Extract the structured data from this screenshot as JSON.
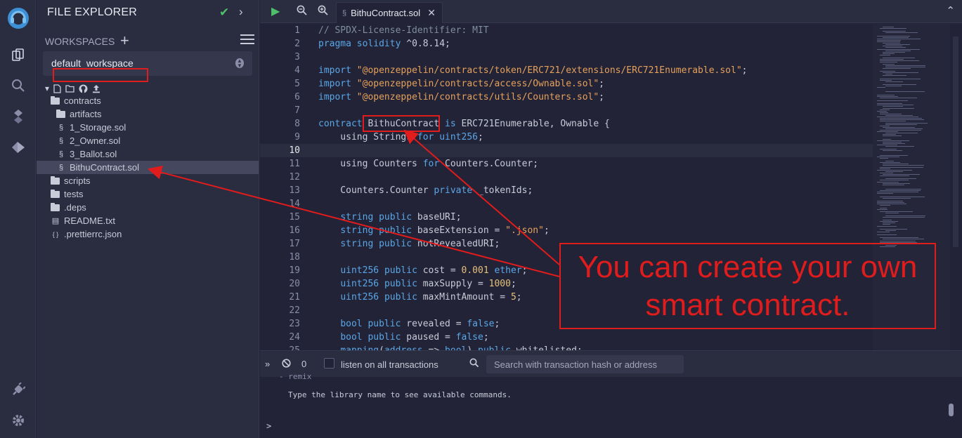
{
  "activity_bar": {
    "icons": [
      "remix-logo-icon",
      "file-explorer-icon",
      "search-icon",
      "solidity-compiler-icon",
      "deploy-run-icon",
      "plugin-manager-icon",
      "settings-icon"
    ]
  },
  "file_explorer": {
    "title": "FILE EXPLORER",
    "workspaces_label": "WORKSPACES",
    "workspace_selected": "default_workspace",
    "tree": [
      {
        "name": "contracts",
        "type": "folder-open",
        "indent": 0
      },
      {
        "name": "artifacts",
        "type": "folder",
        "indent": 1
      },
      {
        "name": "1_Storage.sol",
        "type": "sol",
        "indent": 1
      },
      {
        "name": "2_Owner.sol",
        "type": "sol",
        "indent": 1
      },
      {
        "name": "3_Ballot.sol",
        "type": "sol",
        "indent": 1
      },
      {
        "name": "BithuContract.sol",
        "type": "sol",
        "indent": 1,
        "selected": true
      },
      {
        "name": "scripts",
        "type": "folder",
        "indent": 0
      },
      {
        "name": "tests",
        "type": "folder",
        "indent": 0
      },
      {
        "name": ".deps",
        "type": "folder",
        "indent": 0
      },
      {
        "name": "README.txt",
        "type": "file",
        "indent": 0
      },
      {
        "name": ".prettierrc.json",
        "type": "json",
        "indent": 0
      }
    ]
  },
  "editor": {
    "tab_label": "BithuContract.sol",
    "current_line": 10,
    "lines": [
      [
        [
          "com",
          "// SPDX-License-Identifier: MIT"
        ]
      ],
      [
        [
          "kw",
          "pragma"
        ],
        [
          "plain",
          " "
        ],
        [
          "kw",
          "solidity"
        ],
        [
          "plain",
          " ^0.8.14;"
        ]
      ],
      [],
      [
        [
          "kw",
          "import"
        ],
        [
          "plain",
          " "
        ],
        [
          "str",
          "\"@openzeppelin/contracts/token/ERC721/extensions/ERC721Enumerable.sol\""
        ],
        [
          "plain",
          ";"
        ]
      ],
      [
        [
          "kw",
          "import"
        ],
        [
          "plain",
          " "
        ],
        [
          "str",
          "\"@openzeppelin/contracts/access/Ownable.sol\""
        ],
        [
          "plain",
          ";"
        ]
      ],
      [
        [
          "kw",
          "import"
        ],
        [
          "plain",
          " "
        ],
        [
          "str",
          "\"@openzeppelin/contracts/utils/Counters.sol\""
        ],
        [
          "plain",
          ";"
        ]
      ],
      [],
      [
        [
          "kw",
          "contract"
        ],
        [
          "plain",
          " BithuContract "
        ],
        [
          "kw",
          "is"
        ],
        [
          "plain",
          " ERC721Enumerable, Ownable {"
        ]
      ],
      [
        [
          "plain",
          "    using Strings "
        ],
        [
          "kw",
          "for"
        ],
        [
          "plain",
          " "
        ],
        [
          "kw",
          "uint256"
        ],
        [
          "plain",
          ";"
        ]
      ],
      [],
      [
        [
          "plain",
          "    using Counters "
        ],
        [
          "kw",
          "for"
        ],
        [
          "plain",
          " Counters.Counter;"
        ]
      ],
      [],
      [
        [
          "plain",
          "    Counters.Counter "
        ],
        [
          "kw",
          "private"
        ],
        [
          "plain",
          " _tokenIds;"
        ]
      ],
      [],
      [
        [
          "plain",
          "    "
        ],
        [
          "kw",
          "string"
        ],
        [
          "plain",
          " "
        ],
        [
          "kw",
          "public"
        ],
        [
          "plain",
          " baseURI;"
        ]
      ],
      [
        [
          "plain",
          "    "
        ],
        [
          "kw",
          "string"
        ],
        [
          "plain",
          " "
        ],
        [
          "kw",
          "public"
        ],
        [
          "plain",
          " baseExtension = "
        ],
        [
          "str",
          "\".json\""
        ],
        [
          "plain",
          ";"
        ]
      ],
      [
        [
          "plain",
          "    "
        ],
        [
          "kw",
          "string"
        ],
        [
          "plain",
          " "
        ],
        [
          "kw",
          "public"
        ],
        [
          "plain",
          " notRevealedURI;"
        ]
      ],
      [],
      [
        [
          "plain",
          "    "
        ],
        [
          "kw",
          "uint256"
        ],
        [
          "plain",
          " "
        ],
        [
          "kw",
          "public"
        ],
        [
          "plain",
          " cost = "
        ],
        [
          "num",
          "0.001"
        ],
        [
          "plain",
          " "
        ],
        [
          "kw",
          "ether"
        ],
        [
          "plain",
          ";"
        ]
      ],
      [
        [
          "plain",
          "    "
        ],
        [
          "kw",
          "uint256"
        ],
        [
          "plain",
          " "
        ],
        [
          "kw",
          "public"
        ],
        [
          "plain",
          " maxSupply = "
        ],
        [
          "num",
          "1000"
        ],
        [
          "plain",
          ";"
        ]
      ],
      [
        [
          "plain",
          "    "
        ],
        [
          "kw",
          "uint256"
        ],
        [
          "plain",
          " "
        ],
        [
          "kw",
          "public"
        ],
        [
          "plain",
          " maxMintAmount = "
        ],
        [
          "num",
          "5"
        ],
        [
          "plain",
          ";"
        ]
      ],
      [],
      [
        [
          "plain",
          "    "
        ],
        [
          "kw",
          "bool"
        ],
        [
          "plain",
          " "
        ],
        [
          "kw",
          "public"
        ],
        [
          "plain",
          " revealed = "
        ],
        [
          "kw",
          "false"
        ],
        [
          "plain",
          ";"
        ]
      ],
      [
        [
          "plain",
          "    "
        ],
        [
          "kw",
          "bool"
        ],
        [
          "plain",
          " "
        ],
        [
          "kw",
          "public"
        ],
        [
          "plain",
          " paused = "
        ],
        [
          "kw",
          "false"
        ],
        [
          "plain",
          ";"
        ]
      ],
      [
        [
          "plain",
          "    "
        ],
        [
          "kw",
          "mapping"
        ],
        [
          "plain",
          "("
        ],
        [
          "kw",
          "address"
        ],
        [
          "plain",
          " => "
        ],
        [
          "kw",
          "bool"
        ],
        [
          "plain",
          ") "
        ],
        [
          "kw",
          "public"
        ],
        [
          "plain",
          " whitelisted;"
        ]
      ]
    ]
  },
  "terminal": {
    "count": "0",
    "listen_label": "listen on all transactions",
    "search_placeholder": "Search with transaction hash or address",
    "top_text": "- remix",
    "help_text": "Type the library name to see available commands.",
    "prompt": ">"
  },
  "annotation": {
    "callout_line1": "You can create your own",
    "callout_line2": "smart contract.",
    "color": "#e01c1c"
  }
}
